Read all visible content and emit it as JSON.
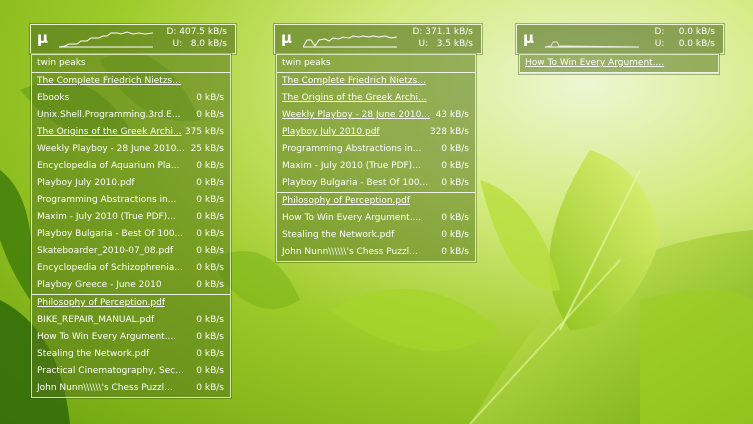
{
  "colors": {
    "accent": "#ffffff",
    "panel": "#58781e"
  },
  "widgets": [
    {
      "icon": "mu-logo",
      "mu": "µ",
      "download": "D: 407.5 kB/s",
      "upload": "U:   8.0 kB/s",
      "items": [
        {
          "name": "twin peaks",
          "rate": ""
        },
        {
          "name": "The Complete Friedrich Nietzs...",
          "rate": ""
        },
        {
          "name": "Ebooks",
          "rate": "0 kB/s"
        },
        {
          "name": "Unix.Shell.Programming.3rd.E...",
          "rate": "0 kB/s"
        },
        {
          "name": "The Origins of the Greek Archi...",
          "rate": "375 kB/s"
        },
        {
          "name": "Weekly Playboy - 28 June 2010...",
          "rate": "25 kB/s"
        },
        {
          "name": "Encyclopedia of Aquarium Pla...",
          "rate": "0 kB/s"
        },
        {
          "name": "Playboy July 2010.pdf",
          "rate": "0 kB/s"
        },
        {
          "name": "Programming Abstractions in...",
          "rate": "0 kB/s"
        },
        {
          "name": "Maxim - July 2010 (True PDF)...",
          "rate": "0 kB/s"
        },
        {
          "name": "Playboy Bulgaria - Best Of 100...",
          "rate": "0 kB/s"
        },
        {
          "name": "Skateboarder_2010-07_08.pdf",
          "rate": "0 kB/s"
        },
        {
          "name": "Encyclopedia of Schizophrenia...",
          "rate": "0 kB/s"
        },
        {
          "name": "Playboy Greece - June 2010",
          "rate": "0 kB/s"
        },
        {
          "name": "Philosophy of Perception.pdf",
          "rate": ""
        },
        {
          "name": "BIKE_REPAIR_MANUAL.pdf",
          "rate": "0 kB/s"
        },
        {
          "name": "How To Win Every Argument....",
          "rate": "0 kB/s"
        },
        {
          "name": "Stealing the Network.pdf",
          "rate": "0 kB/s"
        },
        {
          "name": "Practical Cinematography, Sec...",
          "rate": "0 kB/s"
        },
        {
          "name": "John Nunn\\\\\\\\\\\\'s Chess Puzzl...",
          "rate": "0 kB/s"
        }
      ]
    },
    {
      "icon": "mu-logo",
      "mu": "µ",
      "download": "D: 371.1 kB/s",
      "upload": "U:   3.5 kB/s",
      "items": [
        {
          "name": "twin peaks",
          "rate": ""
        },
        {
          "name": "The Complete Friedrich Nietzs...",
          "rate": ""
        },
        {
          "name": "The Origins of the Greek Archi...",
          "rate": ""
        },
        {
          "name": "Weekly Playboy - 28 June 2010...",
          "rate": "43 kB/s"
        },
        {
          "name": "Playboy July 2010.pdf",
          "rate": "328 kB/s"
        },
        {
          "name": "Programming Abstractions in...",
          "rate": "0 kB/s"
        },
        {
          "name": "Maxim - July 2010 (True PDF)...",
          "rate": "0 kB/s"
        },
        {
          "name": "Playboy Bulgaria - Best Of 100...",
          "rate": "0 kB/s"
        },
        {
          "name": "Philosophy of Perception.pdf",
          "rate": ""
        },
        {
          "name": "How To Win Every Argument....",
          "rate": "0 kB/s"
        },
        {
          "name": "Stealing the Network.pdf",
          "rate": "0 kB/s"
        },
        {
          "name": "John Nunn\\\\\\\\\\\\'s Chess Puzzl...",
          "rate": "0 kB/s"
        }
      ]
    },
    {
      "icon": "mu-logo",
      "mu": "µ",
      "download": "D:     0.0 kB/s",
      "upload": "U:     0.0 kB/s",
      "items": [
        {
          "name": "How To Win Every Argument....",
          "rate": ""
        }
      ]
    }
  ]
}
